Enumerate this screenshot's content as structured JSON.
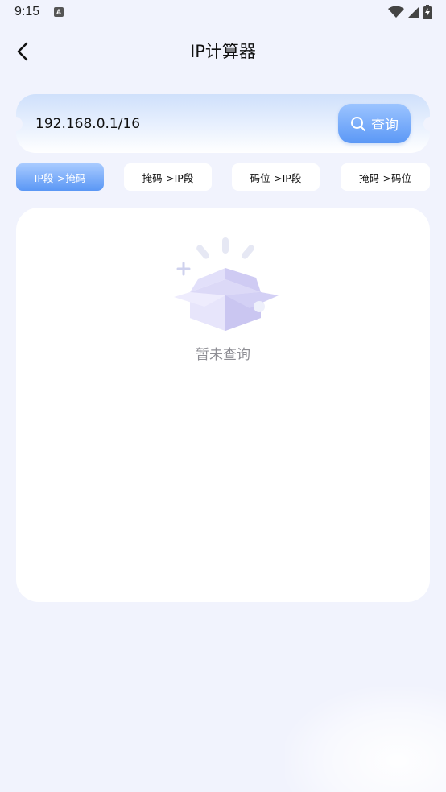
{
  "status": {
    "time": "9:15",
    "app_badge": "A"
  },
  "header": {
    "title": "IP计算器"
  },
  "search": {
    "value": "192.168.0.1/16",
    "button_label": "查询"
  },
  "tabs": [
    {
      "label": "IP段->掩码",
      "active": true
    },
    {
      "label": "掩码->IP段",
      "active": false
    },
    {
      "label": "码位->IP段",
      "active": false
    },
    {
      "label": "掩码->码位",
      "active": false
    }
  ],
  "result": {
    "empty_text": "暂未查询"
  },
  "colors": {
    "accent": "#5b98f6",
    "background": "#f1f3fd",
    "muted_text": "#8e8e94"
  }
}
